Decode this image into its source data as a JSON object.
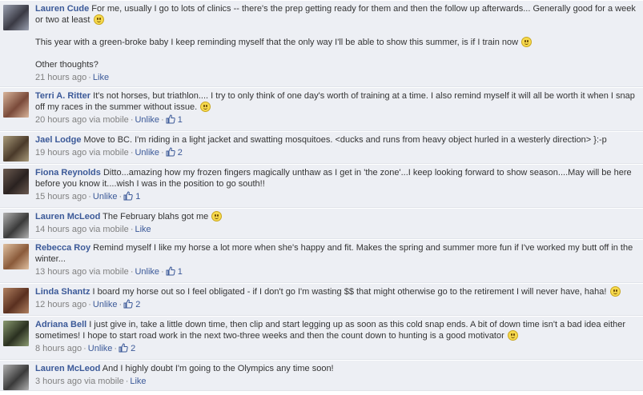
{
  "comments": [
    {
      "author": "Lauren Cude",
      "avatar_colors": [
        "#3a3a44",
        "#9aa0b0"
      ],
      "paragraphs": [
        "For me, usually I go to lots of clinics -- there's the prep getting ready for them and then the follow up afterwards... Generally good for a week or two at least",
        "This year with a green-broke baby I keep reminding myself that the only way I'll be able to show this summer, is if I train now",
        "Other thoughts?"
      ],
      "paragraph_smileys": [
        true,
        true,
        false
      ],
      "time": "21 hours ago",
      "via": "",
      "action": "Like",
      "likes": ""
    },
    {
      "author": "Terri A. Ritter",
      "avatar_colors": [
        "#7a4a3a",
        "#d8b49a"
      ],
      "paragraphs": [
        "It's not horses, but triathlon.... I try to only think of one day's worth of training at a time. I also remind myself it will all be worth it when I snap off my races in the summer without issue."
      ],
      "paragraph_smileys": [
        true
      ],
      "time": "20 hours ago",
      "via": "via mobile",
      "action": "Unlike",
      "likes": "1"
    },
    {
      "author": "Jael Lodge",
      "avatar_colors": [
        "#4a3a2a",
        "#a89a7a"
      ],
      "paragraphs": [
        "Move to BC. I'm riding in a light jacket and swatting mosquitoes.  <ducks and runs from heavy object hurled in a westerly direction> }:-p"
      ],
      "paragraph_smileys": [
        false
      ],
      "time": "19 hours ago",
      "via": "via mobile",
      "action": "Unlike",
      "likes": "2"
    },
    {
      "author": "Fiona Reynolds",
      "avatar_colors": [
        "#2a2220",
        "#6a5a50"
      ],
      "paragraphs": [
        "Ditto...amazing how my frozen fingers magically unthaw as I get in 'the zone'...I keep looking forward to show season....May will be here before you know it....wish I was in the position to go south!!"
      ],
      "paragraph_smileys": [
        false
      ],
      "time": "15 hours ago",
      "via": "",
      "action": "Unlike",
      "likes": "1"
    },
    {
      "author": "Lauren McLeod",
      "avatar_colors": [
        "#3a3a3a",
        "#b0b0b0"
      ],
      "paragraphs": [
        "The February blahs got me"
      ],
      "paragraph_smileys": [
        true
      ],
      "time": "14 hours ago",
      "via": "via mobile",
      "action": "Like",
      "likes": ""
    },
    {
      "author": "Rebecca Roy",
      "avatar_colors": [
        "#8a5a3a",
        "#e0c0a0"
      ],
      "paragraphs": [
        "Remind myself I like my horse a lot more when she's happy and fit. Makes the spring and summer more fun if I've worked my butt off in the winter..."
      ],
      "paragraph_smileys": [
        false
      ],
      "time": "13 hours ago",
      "via": "via mobile",
      "action": "Unlike",
      "likes": "1"
    },
    {
      "author": "Linda Shantz",
      "avatar_colors": [
        "#5a3020",
        "#b08060"
      ],
      "paragraphs": [
        "I board my horse out so I feel obligated - if I don't go I'm wasting $$ that might otherwise go to the retirement I will never have, haha!"
      ],
      "paragraph_smileys": [
        true
      ],
      "time": "12 hours ago",
      "via": "",
      "action": "Unlike",
      "likes": "2"
    },
    {
      "author": "Adriana Bell",
      "avatar_colors": [
        "#2a3020",
        "#8a9a70"
      ],
      "paragraphs": [
        "I just give in, take a little down time, then clip and start legging up as soon as this cold snap ends. A bit of down time isn't a bad idea either sometimes! I hope to start road work in the next two-three weeks and then the count down to hunting is a good motivator"
      ],
      "paragraph_smileys": [
        true
      ],
      "time": "8 hours ago",
      "via": "",
      "action": "Unlike",
      "likes": "2"
    },
    {
      "author": "Lauren McLeod",
      "avatar_colors": [
        "#3a3a3a",
        "#b0b0b0"
      ],
      "paragraphs": [
        "And I highly doubt I'm going to the Olympics any time soon!"
      ],
      "paragraph_smileys": [
        false
      ],
      "time": "3 hours ago",
      "via": "via mobile",
      "action": "Like",
      "likes": ""
    }
  ],
  "colors": {
    "link": "#3b5998",
    "meta": "#808080",
    "comment_bg": "#edeff4"
  },
  "icons": {
    "like": "thumbs-up-icon",
    "smiley": "smiley-icon"
  }
}
